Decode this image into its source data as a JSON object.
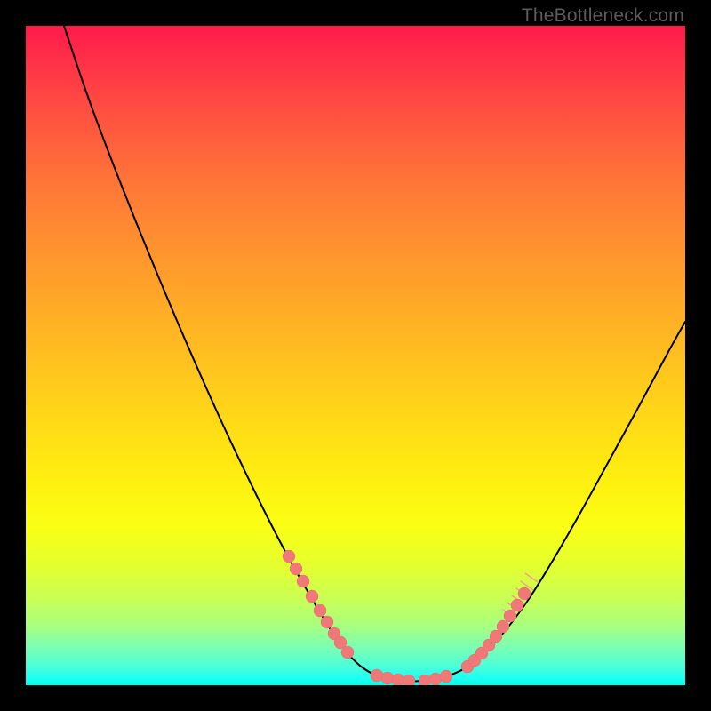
{
  "watermark": "TheBottleneck.com",
  "colors": {
    "frame": "#000000",
    "curve": "#000000",
    "marker_fill": "#f07878",
    "marker_stroke": "#e86a6a"
  },
  "chart_data": {
    "type": "line",
    "title": "",
    "xlabel": "",
    "ylabel": "",
    "xlim": [
      0,
      742
    ],
    "ylim": [
      0,
      742
    ],
    "curve": [
      {
        "x": 43,
        "y": 0
      },
      {
        "x": 70,
        "y": 80
      },
      {
        "x": 100,
        "y": 160
      },
      {
        "x": 140,
        "y": 260
      },
      {
        "x": 180,
        "y": 355
      },
      {
        "x": 220,
        "y": 445
      },
      {
        "x": 258,
        "y": 525
      },
      {
        "x": 290,
        "y": 588
      },
      {
        "x": 318,
        "y": 638
      },
      {
        "x": 342,
        "y": 678
      },
      {
        "x": 362,
        "y": 706
      },
      {
        "x": 380,
        "y": 723
      },
      {
        "x": 400,
        "y": 733
      },
      {
        "x": 422,
        "y": 737
      },
      {
        "x": 446,
        "y": 737
      },
      {
        "x": 470,
        "y": 733
      },
      {
        "x": 494,
        "y": 723
      },
      {
        "x": 516,
        "y": 706
      },
      {
        "x": 540,
        "y": 680
      },
      {
        "x": 566,
        "y": 645
      },
      {
        "x": 594,
        "y": 600
      },
      {
        "x": 624,
        "y": 548
      },
      {
        "x": 656,
        "y": 490
      },
      {
        "x": 690,
        "y": 428
      },
      {
        "x": 724,
        "y": 365
      },
      {
        "x": 742,
        "y": 333
      }
    ],
    "left_markers": [
      {
        "x": 296,
        "y": 597
      },
      {
        "x": 304,
        "y": 611
      },
      {
        "x": 312,
        "y": 625
      },
      {
        "x": 322,
        "y": 642
      },
      {
        "x": 331,
        "y": 658
      },
      {
        "x": 339,
        "y": 671
      },
      {
        "x": 347,
        "y": 684
      },
      {
        "x": 354,
        "y": 694
      },
      {
        "x": 362,
        "y": 705
      }
    ],
    "bottom_markers": [
      {
        "x": 395,
        "y": 731
      },
      {
        "x": 407,
        "y": 734
      },
      {
        "x": 419,
        "y": 736
      },
      {
        "x": 431,
        "y": 737
      },
      {
        "x": 449,
        "y": 737
      },
      {
        "x": 461,
        "y": 735
      },
      {
        "x": 473,
        "y": 732
      }
    ],
    "right_markers": [
      {
        "x": 497,
        "y": 721
      },
      {
        "x": 505,
        "y": 714
      },
      {
        "x": 513,
        "y": 706
      },
      {
        "x": 521,
        "y": 697
      },
      {
        "x": 529,
        "y": 687
      },
      {
        "x": 537,
        "y": 676
      },
      {
        "x": 545,
        "y": 664
      },
      {
        "x": 553,
        "y": 652
      },
      {
        "x": 561,
        "y": 639
      }
    ],
    "right_ticks": [
      {
        "x": 544,
        "y": 662
      },
      {
        "x": 549,
        "y": 654
      },
      {
        "x": 554,
        "y": 646
      },
      {
        "x": 559,
        "y": 638
      },
      {
        "x": 564,
        "y": 630
      },
      {
        "x": 569,
        "y": 621
      }
    ]
  }
}
